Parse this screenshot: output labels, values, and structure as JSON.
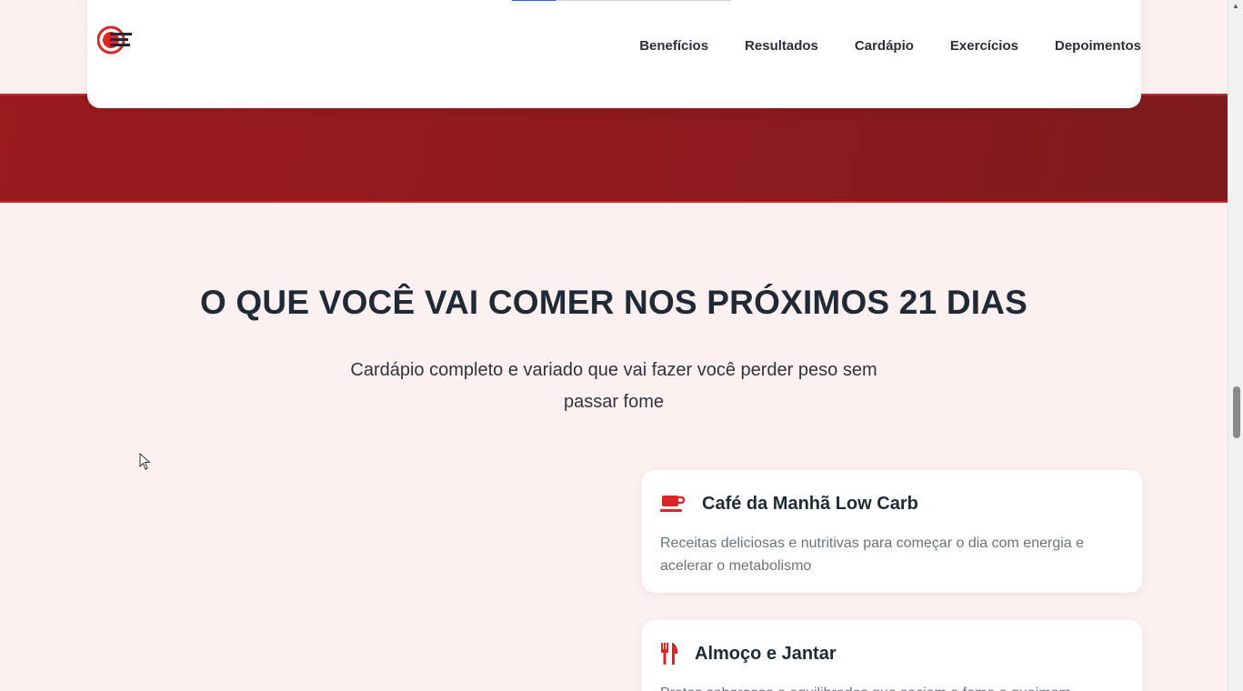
{
  "header": {
    "logo_alt": "Projeto 21 Dias",
    "nav": [
      "Benefícios",
      "Resultados",
      "Cardápio",
      "Exercícios",
      "Depoimentos"
    ]
  },
  "stats": {
    "progress_fraction": 0.2
  },
  "section": {
    "title": "O QUE VOCÊ VAI COMER NOS PRÓXIMOS 21 DIAS",
    "subtitle_line1": "Cardápio completo e variado que vai fazer você perder peso sem",
    "subtitle_line2": "passar fome"
  },
  "cards": [
    {
      "icon": "coffee-cup-icon",
      "title": "Café da Manhã Low Carb",
      "desc": "Receitas deliciosas e nutritivas para começar o dia com energia e acelerar o metabolismo"
    },
    {
      "icon": "utensils-icon",
      "title": "Almoço e Jantar",
      "desc": "Pratos saborosos e equilibrados que saciam a fome e queimam"
    }
  ],
  "colors": {
    "accent": "#dc2626",
    "band": "#8f1a1e",
    "background": "#fdf0f0"
  }
}
